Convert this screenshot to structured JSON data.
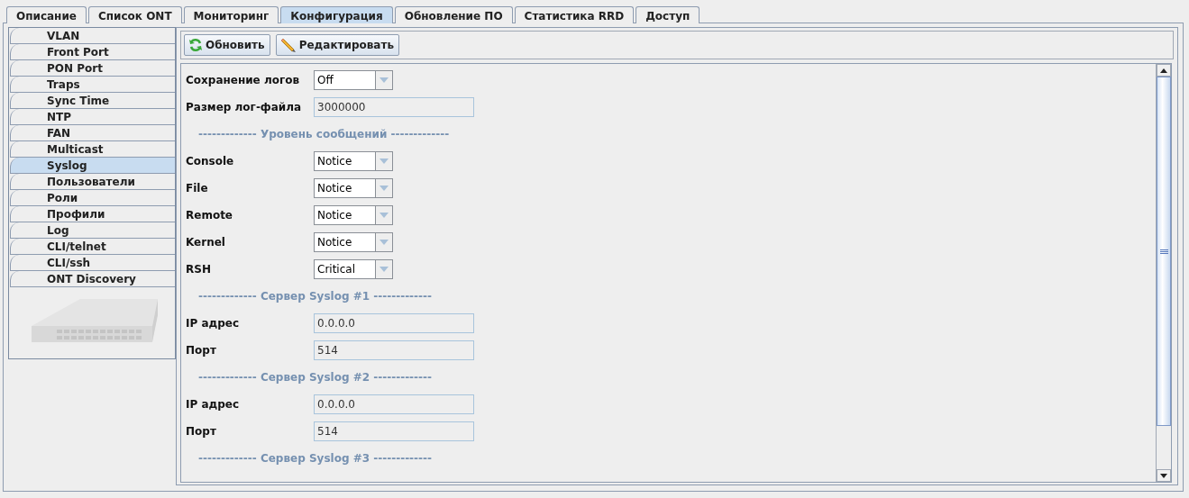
{
  "tabs": [
    {
      "label": "Описание",
      "selected": false
    },
    {
      "label": "Список ONT",
      "selected": false
    },
    {
      "label": "Мониторинг",
      "selected": false
    },
    {
      "label": "Конфигурация",
      "selected": true
    },
    {
      "label": "Обновление ПО",
      "selected": false
    },
    {
      "label": "Статистика RRD",
      "selected": false
    },
    {
      "label": "Доступ",
      "selected": false
    }
  ],
  "sidebar": {
    "items": [
      {
        "label": "VLAN",
        "selected": false
      },
      {
        "label": "Front Port",
        "selected": false
      },
      {
        "label": "PON Port",
        "selected": false
      },
      {
        "label": "Traps",
        "selected": false
      },
      {
        "label": "Sync Time",
        "selected": false
      },
      {
        "label": "NTP",
        "selected": false
      },
      {
        "label": "FAN",
        "selected": false
      },
      {
        "label": "Multicast",
        "selected": false
      },
      {
        "label": "Syslog",
        "selected": true
      },
      {
        "label": "Пользователи",
        "selected": false
      },
      {
        "label": "Роли",
        "selected": false
      },
      {
        "label": "Профили",
        "selected": false
      },
      {
        "label": "Log",
        "selected": false
      },
      {
        "label": "CLI/telnet",
        "selected": false
      },
      {
        "label": "CLI/ssh",
        "selected": false
      },
      {
        "label": "ONT Discovery",
        "selected": false
      }
    ]
  },
  "toolbar": [
    {
      "label": "Обновить",
      "kind": "refresh"
    },
    {
      "label": "Редактировать",
      "kind": "edit"
    }
  ],
  "form": [
    {
      "kind": "select",
      "label": "Сохранение логов",
      "value": "Off"
    },
    {
      "kind": "text",
      "label": "Размер лог-файла",
      "value": "3000000"
    },
    {
      "kind": "section",
      "label": "------------- Уровень сообщений -------------"
    },
    {
      "kind": "select",
      "label": "Console",
      "value": "Notice"
    },
    {
      "kind": "select",
      "label": "File",
      "value": "Notice"
    },
    {
      "kind": "select",
      "label": "Remote",
      "value": "Notice"
    },
    {
      "kind": "select",
      "label": "Kernel",
      "value": "Notice"
    },
    {
      "kind": "select",
      "label": "RSH",
      "value": "Critical"
    },
    {
      "kind": "section",
      "label": "------------- Сервер Syslog #1 -------------"
    },
    {
      "kind": "text",
      "label": "IP адрес",
      "value": "0.0.0.0"
    },
    {
      "kind": "text",
      "label": "Порт",
      "value": "514"
    },
    {
      "kind": "section",
      "label": "------------- Сервер Syslog #2 -------------"
    },
    {
      "kind": "text",
      "label": "IP адрес",
      "value": "0.0.0.0"
    },
    {
      "kind": "text",
      "label": "Порт",
      "value": "514"
    },
    {
      "kind": "section",
      "label": "------------- Сервер Syslog #3 -------------"
    }
  ]
}
